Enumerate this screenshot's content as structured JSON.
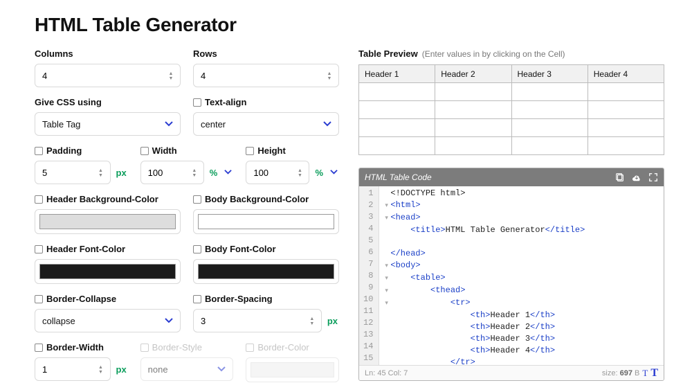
{
  "title": "HTML Table Generator",
  "fields": {
    "columns": {
      "label": "Columns",
      "value": "4"
    },
    "rows": {
      "label": "Rows",
      "value": "4"
    },
    "css_using": {
      "label": "Give CSS using",
      "value": "Table Tag"
    },
    "text_align": {
      "label": "Text-align",
      "value": "center"
    },
    "padding": {
      "label": "Padding",
      "value": "5",
      "unit": "px"
    },
    "width": {
      "label": "Width",
      "value": "100",
      "unit": "%"
    },
    "height": {
      "label": "Height",
      "value": "100",
      "unit": "%"
    },
    "header_bg": {
      "label": "Header Background-Color"
    },
    "body_bg": {
      "label": "Body Background-Color"
    },
    "header_font": {
      "label": "Header Font-Color"
    },
    "body_font": {
      "label": "Body Font-Color"
    },
    "border_collapse": {
      "label": "Border-Collapse",
      "value": "collapse"
    },
    "border_spacing": {
      "label": "Border-Spacing",
      "value": "3",
      "unit": "px"
    },
    "border_width": {
      "label": "Border-Width",
      "value": "1",
      "unit": "px"
    },
    "border_style": {
      "label": "Border-Style",
      "value": "none"
    },
    "border_color": {
      "label": "Border-Color"
    }
  },
  "preview": {
    "title": "Table Preview",
    "hint": "(Enter values in by clicking on the Cell)",
    "headers": [
      "Header 1",
      "Header 2",
      "Header 3",
      "Header 4"
    ]
  },
  "code": {
    "title": "HTML Table Code",
    "lines": [
      {
        "n": "1",
        "indent": 0,
        "fold": "",
        "parts": [
          [
            "txt",
            "<!DOCTYPE html>"
          ]
        ]
      },
      {
        "n": "2",
        "indent": 0,
        "fold": "▾",
        "parts": [
          [
            "tag",
            "<html>"
          ]
        ]
      },
      {
        "n": "3",
        "indent": 0,
        "fold": "▾",
        "parts": [
          [
            "tag",
            "<head>"
          ]
        ]
      },
      {
        "n": "4",
        "indent": 1,
        "fold": "",
        "parts": [
          [
            "tag",
            "<title>"
          ],
          [
            "txt",
            "HTML Table Generator"
          ],
          [
            "tag",
            "</title>"
          ]
        ]
      },
      {
        "n": "5",
        "indent": 0,
        "fold": "",
        "parts": []
      },
      {
        "n": "6",
        "indent": 0,
        "fold": "",
        "parts": [
          [
            "tag",
            "</head>"
          ]
        ]
      },
      {
        "n": "7",
        "indent": 0,
        "fold": "▾",
        "parts": [
          [
            "tag",
            "<body>"
          ]
        ]
      },
      {
        "n": "8",
        "indent": 1,
        "fold": "▾",
        "parts": [
          [
            "tag",
            "<table>"
          ]
        ]
      },
      {
        "n": "9",
        "indent": 2,
        "fold": "▾",
        "parts": [
          [
            "tag",
            "<thead>"
          ]
        ]
      },
      {
        "n": "10",
        "indent": 3,
        "fold": "▾",
        "parts": [
          [
            "tag",
            "<tr>"
          ]
        ]
      },
      {
        "n": "11",
        "indent": 4,
        "fold": "",
        "parts": [
          [
            "tag",
            "<th>"
          ],
          [
            "txt",
            "Header 1"
          ],
          [
            "tag",
            "</th>"
          ]
        ]
      },
      {
        "n": "12",
        "indent": 4,
        "fold": "",
        "parts": [
          [
            "tag",
            "<th>"
          ],
          [
            "txt",
            "Header 2"
          ],
          [
            "tag",
            "</th>"
          ]
        ]
      },
      {
        "n": "13",
        "indent": 4,
        "fold": "",
        "parts": [
          [
            "tag",
            "<th>"
          ],
          [
            "txt",
            "Header 3"
          ],
          [
            "tag",
            "</th>"
          ]
        ]
      },
      {
        "n": "14",
        "indent": 4,
        "fold": "",
        "parts": [
          [
            "tag",
            "<th>"
          ],
          [
            "txt",
            "Header 4"
          ],
          [
            "tag",
            "</th>"
          ]
        ]
      },
      {
        "n": "15",
        "indent": 3,
        "fold": "",
        "parts": [
          [
            "tag",
            "</tr>"
          ]
        ]
      }
    ],
    "footer": {
      "pos": "Ln: 45 Col: 7",
      "size_label": "size: ",
      "size_value": "697",
      "size_unit": " B"
    }
  }
}
